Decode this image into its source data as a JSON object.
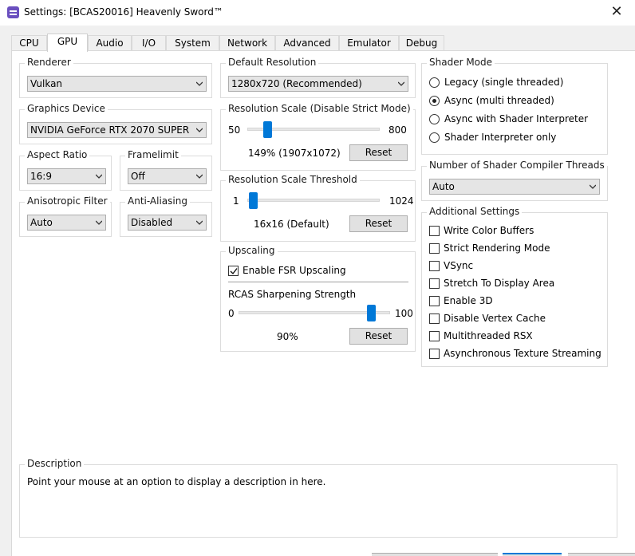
{
  "window": {
    "title": "Settings: [BCAS20016] Heavenly Sword™",
    "close_glyph": "✕"
  },
  "tabs": [
    {
      "label": "CPU"
    },
    {
      "label": "GPU"
    },
    {
      "label": "Audio"
    },
    {
      "label": "I/O"
    },
    {
      "label": "System"
    },
    {
      "label": "Network"
    },
    {
      "label": "Advanced"
    },
    {
      "label": "Emulator"
    },
    {
      "label": "Debug"
    }
  ],
  "active_tab": "GPU",
  "renderer": {
    "title": "Renderer",
    "value": "Vulkan"
  },
  "graphics_device": {
    "title": "Graphics Device",
    "value": "NVIDIA GeForce RTX 2070 SUPER"
  },
  "aspect_ratio": {
    "title": "Aspect Ratio",
    "value": "16:9"
  },
  "framelimit": {
    "title": "Framelimit",
    "value": "Off"
  },
  "anisotropic": {
    "title": "Anisotropic Filter",
    "value": "Auto"
  },
  "anti_aliasing": {
    "title": "Anti-Aliasing",
    "value": "Disabled"
  },
  "default_resolution": {
    "title": "Default Resolution",
    "value": "1280x720 (Recommended)"
  },
  "resolution_scale": {
    "title": "Resolution Scale (Disable Strict Mode)",
    "min": "50",
    "max": "800",
    "level": 149,
    "readout": "149% (1907x1072)",
    "reset_label": "Reset"
  },
  "resolution_threshold": {
    "title": "Resolution Scale Threshold",
    "min": "1",
    "max": "1024",
    "level": 16,
    "readout": "16x16 (Default)",
    "reset_label": "Reset"
  },
  "upscaling": {
    "title": "Upscaling",
    "fsr_label": "Enable FSR Upscaling",
    "fsr_checked": true,
    "rcas_label": "RCAS Sharpening Strength",
    "min": "0",
    "max": "100",
    "level": 90,
    "readout": "90%",
    "reset_label": "Reset"
  },
  "shader_mode": {
    "title": "Shader Mode",
    "options": [
      {
        "label": "Legacy (single threaded)",
        "selected": false
      },
      {
        "label": "Async (multi threaded)",
        "selected": true
      },
      {
        "label": "Async with Shader Interpreter",
        "selected": false
      },
      {
        "label": "Shader Interpreter only",
        "selected": false
      }
    ]
  },
  "compiler_threads": {
    "title": "Number of Shader Compiler Threads",
    "value": "Auto"
  },
  "additional_settings": {
    "title": "Additional Settings",
    "items": [
      {
        "label": "Write Color Buffers",
        "checked": false
      },
      {
        "label": "Strict Rendering Mode",
        "checked": false
      },
      {
        "label": "VSync",
        "checked": false
      },
      {
        "label": "Stretch To Display Area",
        "checked": false
      },
      {
        "label": "Enable 3D",
        "checked": false
      },
      {
        "label": "Disable Vertex Cache",
        "checked": false
      },
      {
        "label": "Multithreaded RSX",
        "checked": false
      },
      {
        "label": "Asynchronous Texture Streaming",
        "checked": false
      }
    ]
  },
  "description": {
    "title": "Description",
    "text": "Point your mouse at an option to display a description in here."
  },
  "colors": {
    "accent": "#0078d7",
    "window_bg": "#f0f0f0",
    "panel_bg": "#ffffff"
  },
  "icons": {
    "app": "rpcs3-app-icon",
    "close": "close-icon",
    "dropdown": "chevron-down-icon",
    "check": "checkmark-icon"
  }
}
